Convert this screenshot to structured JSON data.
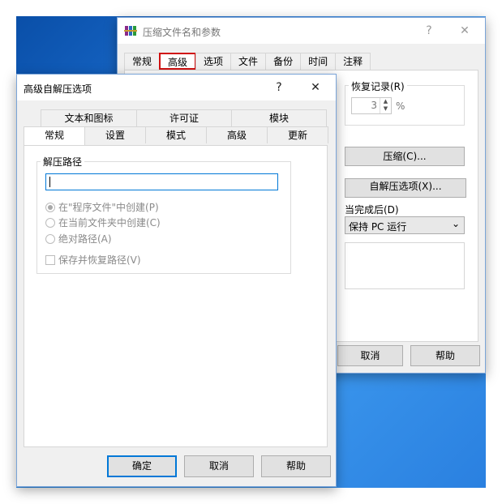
{
  "back_window": {
    "title": "压缩文件名和参数",
    "help_symbol": "?",
    "close_symbol": "✕",
    "tabs": [
      {
        "label": "常规"
      },
      {
        "label": "高级"
      },
      {
        "label": "选项"
      },
      {
        "label": "文件"
      },
      {
        "label": "备份"
      },
      {
        "label": "时间"
      },
      {
        "label": "注释"
      }
    ],
    "active_tab": "高级",
    "recovery_label": "恢复记录(R)",
    "recovery_value": "3",
    "recovery_unit": "%",
    "compress_button": "压缩(C)...",
    "sfx_button": "自解压选项(X)...",
    "after_done_label": "当完成后(D)",
    "after_done_value": "保持 PC 运行",
    "cancel_button": "取消",
    "help_button": "帮助"
  },
  "sfx_dialog": {
    "title": "高级自解压选项",
    "help_symbol": "?",
    "close_symbol": "✕",
    "tabs_row1": [
      {
        "label": "文本和图标"
      },
      {
        "label": "许可证"
      },
      {
        "label": "模块"
      }
    ],
    "tabs_row2": [
      {
        "label": "常规"
      },
      {
        "label": "设置"
      },
      {
        "label": "模式"
      },
      {
        "label": "高级"
      },
      {
        "label": "更新"
      }
    ],
    "active_tab": "常规",
    "path_group_label": "解压路径",
    "path_value": "",
    "radios": [
      {
        "label": "在\"程序文件\"中创建(P)",
        "checked": true
      },
      {
        "label": "在当前文件夹中创建(C)",
        "checked": false
      },
      {
        "label": "绝对路径(A)",
        "checked": false
      }
    ],
    "save_restore_label": "保存并恢复路径(V)",
    "save_restore_checked": false,
    "ok_button": "确定",
    "cancel_button": "取消",
    "help_button": "帮助"
  },
  "colors": {
    "highlight": "#d01010",
    "dialog_bg": "#f0f0f0",
    "focus_border": "#0078d7"
  }
}
